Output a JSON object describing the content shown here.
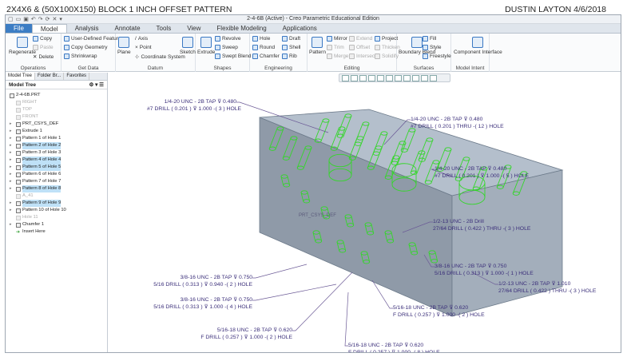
{
  "page": {
    "title_left": "2X4X6 & (50X100X150) BLOCK 1 INCH OFFSET PATTERN",
    "title_right": "DUSTIN LAYTON 4/6/2018"
  },
  "window": {
    "title": "2-4-6B (Active) - Creo Parametric Educational Edition"
  },
  "tabs": [
    "File",
    "Model",
    "Analysis",
    "Annotate",
    "Tools",
    "View",
    "Flexible Modeling",
    "Applications"
  ],
  "ribbon": {
    "operations": {
      "label": "Operations",
      "regenerate": "Regenerate",
      "copy": "Copy",
      "paste": "Paste",
      "delete": "Delete"
    },
    "get_data": {
      "label": "Get Data",
      "udf": "User-Defined Feature",
      "copy_geometry": "Copy Geometry",
      "shrinkwrap": "Shrinkwrap"
    },
    "datum": {
      "label": "Datum",
      "plane": "Plane",
      "axis": "Axis",
      "point": "Point",
      "csys": "Coordinate System",
      "sketch": "Sketch"
    },
    "shapes": {
      "label": "Shapes",
      "extrude": "Extrude",
      "revolve": "Revolve",
      "sweep": "Sweep",
      "swept_blend": "Swept Blend"
    },
    "engineering": {
      "label": "Engineering",
      "hole": "Hole",
      "round": "Round",
      "chamfer": "Chamfer",
      "draft": "Draft",
      "shell": "Shell",
      "rib": "Rib"
    },
    "editing": {
      "label": "Editing",
      "pattern": "Pattern",
      "mirror": "Mirror",
      "trim": "Trim",
      "merge": "Merge",
      "extend": "Extend",
      "offset": "Offset",
      "intersect": "Intersect",
      "project": "Project",
      "thicken": "Thicken",
      "solidify": "Solidify"
    },
    "surfaces": {
      "label": "Surfaces",
      "boundary_blend": "Boundary Blend",
      "fill": "Fill",
      "style": "Style",
      "freestyle": "Freestyle"
    },
    "model_intent": {
      "label": "Model Intent",
      "component_interface": "Component Interface"
    }
  },
  "left_panel": {
    "tabs": [
      "Model Tree",
      "Folder Br...",
      "Favorites"
    ],
    "header": "Model Tree",
    "items": [
      {
        "label": "2-4-6B.PRT",
        "state": "root"
      },
      {
        "label": "RIGHT",
        "state": "grey"
      },
      {
        "label": "TOP",
        "state": "grey"
      },
      {
        "label": "FRONT",
        "state": "grey"
      },
      {
        "label": "PRT_CSYS_DEF",
        "state": "normal"
      },
      {
        "label": "Extrude 1",
        "state": "normal"
      },
      {
        "label": "Pattern 1 of Hole 1",
        "state": "normal"
      },
      {
        "label": "Pattern 2 of Hole 2",
        "state": "selected"
      },
      {
        "label": "Pattern 3 of Hole 3",
        "state": "normal"
      },
      {
        "label": "Pattern 4 of Hole 4",
        "state": "selected"
      },
      {
        "label": "Pattern 5 of Hole 5",
        "state": "selected"
      },
      {
        "label": "Pattern 6 of Hole 6",
        "state": "normal"
      },
      {
        "label": "Pattern 7 of Hole 7",
        "state": "normal"
      },
      {
        "label": "Pattern 8 of Hole 8",
        "state": "selected"
      },
      {
        "label": "A_41",
        "state": "grey"
      },
      {
        "label": "Pattern 9 of Hole 9",
        "state": "selected"
      },
      {
        "label": "Pattern 10 of Hole 10",
        "state": "normal"
      },
      {
        "label": "Hole 11",
        "state": "grey"
      },
      {
        "label": "Chamfer 1",
        "state": "normal"
      },
      {
        "label": "Insert Here",
        "state": "insert"
      }
    ]
  },
  "annotations": [
    {
      "l1": "1/4-20 UNC - 2B TAP ⊽ 0.480",
      "l2": "#7 DRILL ( 0.201 ) ⊽ 1.000 -( 3 ) HOLE"
    },
    {
      "l1": "1/4-20 UNC - 2B TAP ⊽ 0.480",
      "l2": "#7 DRILL ( 0.201 )  THRU  -( 12 ) HOLE"
    },
    {
      "l1": "1/4-20 UNC - 2B TAP ⊽ 0.480",
      "l2": "#7 DRILL ( 0.201 ) ⊽ 1.000 -( 5 ) HOLE"
    },
    {
      "l1": "1/2-13 UNC - 2B Drill",
      "l2": "27/64 DRILL ( 0.422 )  THRU  -( 3 ) HOLE"
    },
    {
      "l1": "3/8-16 UNC - 2B TAP ⊽ 0.750",
      "l2": "5/16 DRILL ( 0.313 ) ⊽ 1.000 -( 1 ) HOLE"
    },
    {
      "l1": "1/2-13 UNC - 2B TAP ⊽ 1.010",
      "l2": "27/64 DRILL ( 0.422 )  THRU  -( 3 ) HOLE"
    },
    {
      "l1": "5/16-18 UNC - 2B TAP ⊽ 0.620",
      "l2": "F DRILL ( 0.257 ) ⊽ 1.000 -( 2 ) HOLE"
    },
    {
      "l1": "3/8-16 UNC - 2B TAP ⊽ 0.750",
      "l2": "5/16 DRILL ( 0.313 ) ⊽ 0.940 -( 2 ) HOLE"
    },
    {
      "l1": "3/8-16 UNC - 2B TAP ⊽ 0.750",
      "l2": "5/16 DRILL ( 0.313 ) ⊽ 1.000 -( 4 ) HOLE"
    },
    {
      "l1": "5/16-18 UNC - 2B TAP ⊽ 0.620",
      "l2": "F DRILL ( 0.257 ) ⊽ 1.000 -( 2 ) HOLE"
    },
    {
      "l1": "5/16-18 UNC - 2B TAP ⊽ 0.620",
      "l2": "F DRILL ( 0.257 ) ⊽ 1.000 -( 8 ) HOLE"
    }
  ],
  "model_watermark": "PRT_CSYS_DEF",
  "colors": {
    "block": "#a8b3c0",
    "hole_wire": "#35d62b",
    "annotation": "#3b2f7a",
    "leader": "#6b5a96",
    "accent": "#3c7dc4"
  }
}
